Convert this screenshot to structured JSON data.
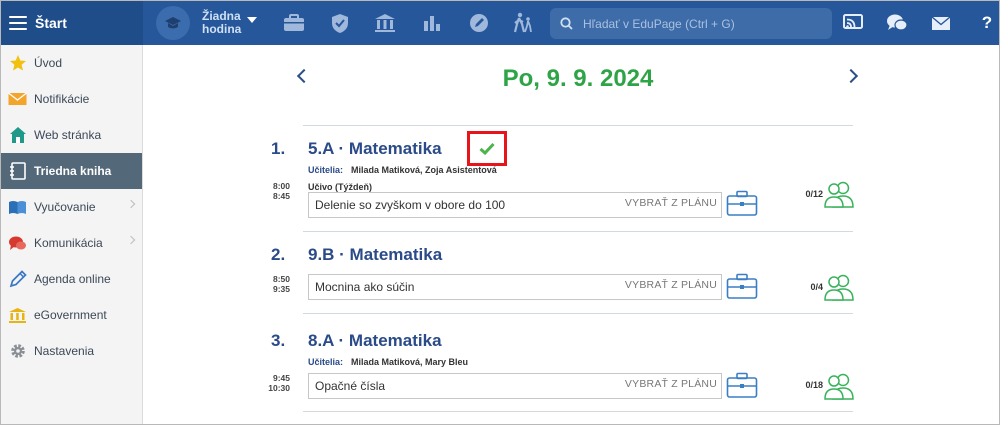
{
  "header": {
    "title": "Štart",
    "lesson_selector": {
      "line1": "Žiadna",
      "line2": "hodina"
    },
    "search_placeholder": "Hľadať v EduPage (Ctrl + G)",
    "help": "?"
  },
  "sidebar": {
    "items": [
      {
        "label": "Úvod",
        "icon": "star-icon"
      },
      {
        "label": "Notifikácie",
        "icon": "envelope-icon"
      },
      {
        "label": "Web stránka",
        "icon": "house-icon"
      },
      {
        "label": "Triedna kniha",
        "icon": "notebook-icon",
        "active": true
      },
      {
        "label": "Vyučovanie",
        "icon": "book-icon"
      },
      {
        "label": "Komunikácia",
        "icon": "chat-icon"
      },
      {
        "label": "Agenda online",
        "icon": "pen-icon"
      },
      {
        "label": "eGovernment",
        "icon": "institution-icon"
      },
      {
        "label": "Nastavenia",
        "icon": "gear-icon"
      }
    ]
  },
  "main": {
    "date": "Po, 9. 9. 2024",
    "plan_label": "VYBRAŤ Z PLÁNU",
    "teachers_label": "Učitelia:",
    "lessons": [
      {
        "number": "1.",
        "title": "5.A · Matematika",
        "teachers": "Milada Matiková, Zoja Asistentová",
        "curriculum": "Učivo (Týždeň)",
        "time_start": "8:00",
        "time_end": "8:45",
        "topic": "Delenie so zvyškom v obore do 100",
        "count": "0/12"
      },
      {
        "number": "2.",
        "title": "9.B · Matematika",
        "time_start": "8:50",
        "time_end": "9:35",
        "topic": "Mocnina ako súčin",
        "count": "0/4"
      },
      {
        "number": "3.",
        "title": "8.A · Matematika",
        "teachers": "Milada Matiková, Mary Bleu",
        "time_start": "9:45",
        "time_end": "10:30",
        "topic": "Opačné čísla",
        "count": "0/18"
      }
    ]
  },
  "colors": {
    "topbar": "#26579a",
    "accent_green": "#2ea446",
    "title_blue": "#2a4a88",
    "highlight_red": "#e8141c"
  }
}
